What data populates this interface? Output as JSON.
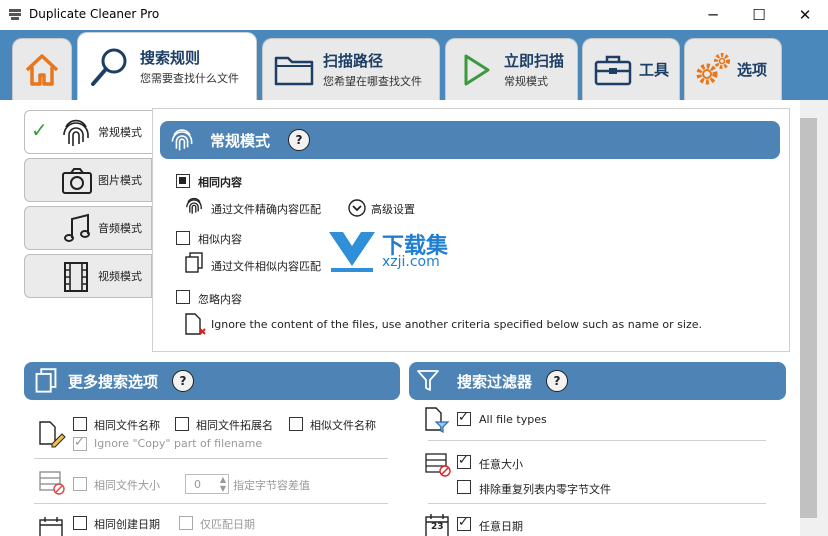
{
  "window": {
    "title": "Duplicate Cleaner Pro",
    "min": "─",
    "max": "☐",
    "close": "✕"
  },
  "tabs": [
    {
      "title": "",
      "sub": ""
    },
    {
      "title": "搜索规则",
      "sub": "您需要查找什么文件"
    },
    {
      "title": "扫描路径",
      "sub": "您希望在哪查找文件"
    },
    {
      "title": "立即扫描",
      "sub": "常规模式"
    },
    {
      "title": "工具",
      "sub": ""
    },
    {
      "title": "选项",
      "sub": ""
    }
  ],
  "modes": [
    "常规模式",
    "图片模式",
    "音频模式",
    "视频模式"
  ],
  "normal": {
    "header": "常规模式",
    "help": "?",
    "same": "相同内容",
    "same_sub": "通过文件精确内容匹配",
    "advanced": "高级设置",
    "similar": "相似内容",
    "similar_sub": "通过文件相似内容匹配",
    "ignore": "忽略内容",
    "ignore_sub": "Ignore the content of the files, use another criteria specified below such as name or size."
  },
  "watermark": {
    "cn": "下载集",
    "en": "xzji.com"
  },
  "more": {
    "header": "更多搜索选项",
    "help": "?",
    "same_name": "相同文件名称",
    "same_ext": "相同文件拓展名",
    "similar_name": "相似文件名称",
    "ignore_copy": "Ignore \"Copy\" part of filename",
    "same_size": "相同文件大小",
    "size_val": "0",
    "size_note": "指定字节容差值",
    "same_date": "相同创建日期",
    "only_date": "仅匹配日期"
  },
  "filter": {
    "header": "搜索过滤器",
    "help": "?",
    "all_types": "All file types",
    "any_size": "任意大小",
    "exclude_zero": "排除重复列表内零字节文件",
    "any_date": "任意日期"
  },
  "calendar_num": "23",
  "colors": {
    "accent": "#4d84b5",
    "tabstrip": "#4a88bc",
    "orange": "#e8761c",
    "green": "#3c9a3c"
  }
}
